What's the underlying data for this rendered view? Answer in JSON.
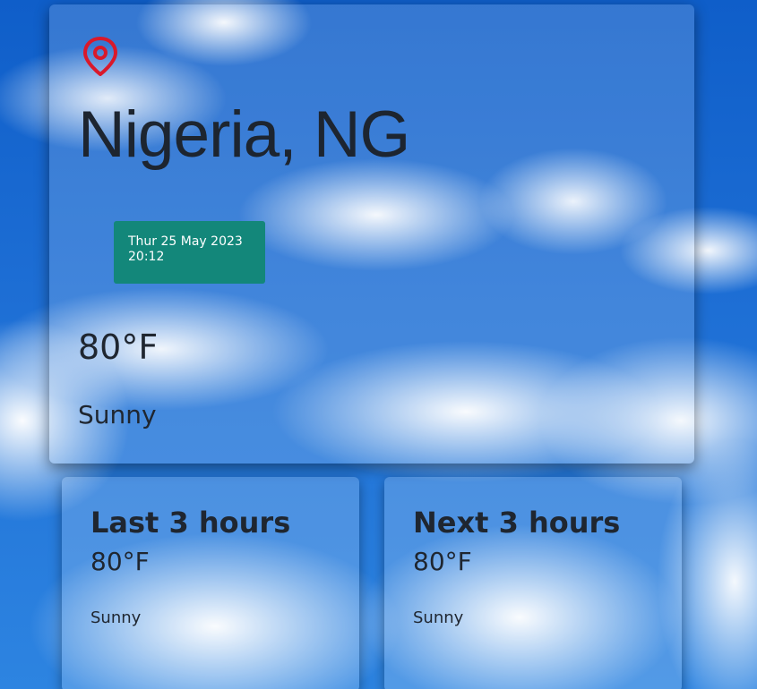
{
  "current": {
    "location_icon": "location-pin-icon",
    "city": "Nigeria, NG",
    "date": "Thur 25 May 2023",
    "time": "20:12",
    "temperature": "80°F",
    "condition": "Sunny"
  },
  "last_3_hours": {
    "title": "Last 3 hours",
    "temperature": "80°F",
    "condition": "Sunny"
  },
  "next_3_hours": {
    "title": "Next 3 hours",
    "temperature": "80°F",
    "condition": "Sunny"
  },
  "colors": {
    "pin": "#d9192b",
    "badge": "#13877a",
    "text": "#1f2630",
    "sky": "#1e6fd5"
  }
}
